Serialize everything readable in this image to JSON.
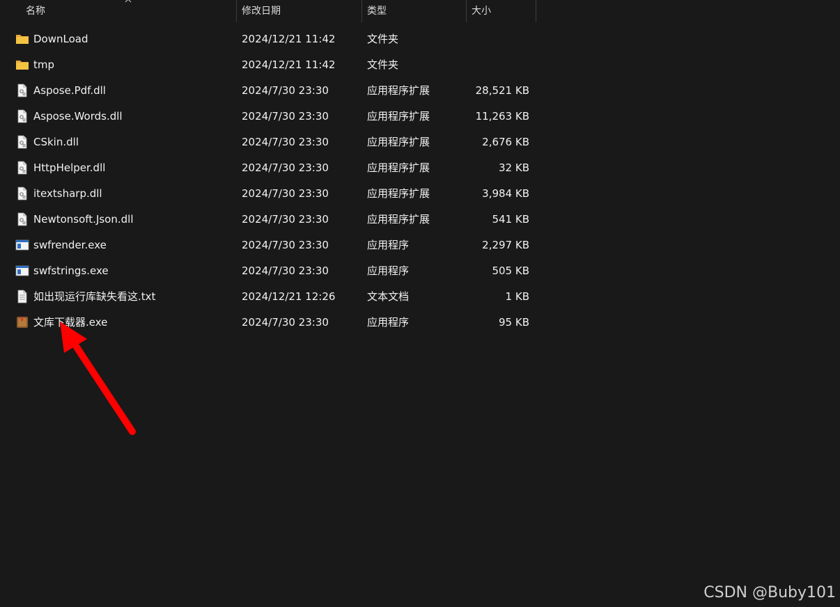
{
  "header": {
    "name": "名称",
    "date": "修改日期",
    "type": "类型",
    "size": "大小"
  },
  "files": [
    {
      "name": "DownLoad",
      "date": "2024/12/21 11:42",
      "type": "文件夹",
      "size": "",
      "icon": "folder-icon"
    },
    {
      "name": "tmp",
      "date": "2024/12/21 11:42",
      "type": "文件夹",
      "size": "",
      "icon": "folder-icon"
    },
    {
      "name": "Aspose.Pdf.dll",
      "date": "2024/7/30 23:30",
      "type": "应用程序扩展",
      "size": "28,521 KB",
      "icon": "dll-file-icon"
    },
    {
      "name": "Aspose.Words.dll",
      "date": "2024/7/30 23:30",
      "type": "应用程序扩展",
      "size": "11,263 KB",
      "icon": "dll-file-icon"
    },
    {
      "name": "CSkin.dll",
      "date": "2024/7/30 23:30",
      "type": "应用程序扩展",
      "size": "2,676 KB",
      "icon": "dll-file-icon"
    },
    {
      "name": "HttpHelper.dll",
      "date": "2024/7/30 23:30",
      "type": "应用程序扩展",
      "size": "32 KB",
      "icon": "dll-file-icon"
    },
    {
      "name": "itextsharp.dll",
      "date": "2024/7/30 23:30",
      "type": "应用程序扩展",
      "size": "3,984 KB",
      "icon": "dll-file-icon"
    },
    {
      "name": "Newtonsoft.Json.dll",
      "date": "2024/7/30 23:30",
      "type": "应用程序扩展",
      "size": "541 KB",
      "icon": "dll-file-icon"
    },
    {
      "name": "swfrender.exe",
      "date": "2024/7/30 23:30",
      "type": "应用程序",
      "size": "2,297 KB",
      "icon": "exe-window-icon"
    },
    {
      "name": "swfstrings.exe",
      "date": "2024/7/30 23:30",
      "type": "应用程序",
      "size": "505 KB",
      "icon": "exe-window-icon"
    },
    {
      "name": "如出现运行库缺失看这.txt",
      "date": "2024/12/21 12:26",
      "type": "文本文档",
      "size": "1 KB",
      "icon": "text-file-icon"
    },
    {
      "name": "文库下载器.exe",
      "date": "2024/7/30 23:30",
      "type": "应用程序",
      "size": "95 KB",
      "icon": "app-book-icon"
    }
  ],
  "watermark": "CSDN @Buby101",
  "colors": {
    "background": "#191919",
    "folder": "#f5c342",
    "arrow": "#ff0000"
  }
}
